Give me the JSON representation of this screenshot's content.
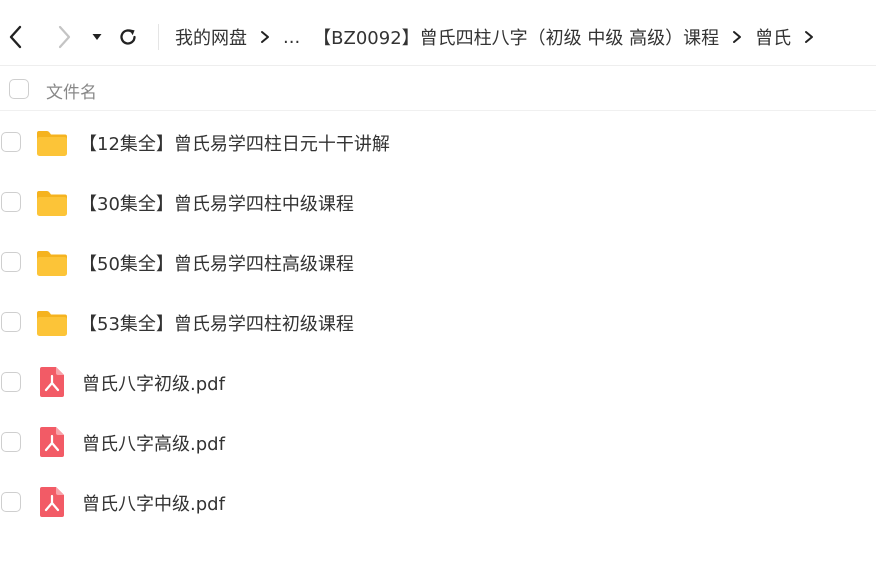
{
  "toolbar": {
    "back_icon": "chevron-left-icon",
    "forward_icon": "chevron-right-icon",
    "history_icon": "caret-down-icon",
    "refresh_icon": "refresh-icon"
  },
  "breadcrumb": [
    {
      "label": "我的网盘"
    },
    {
      "label": "..."
    },
    {
      "label": "【BZ0092】曾氏四柱八字（初级 中级 高级）课程"
    },
    {
      "label": "曾氏"
    }
  ],
  "header": {
    "column_name": "文件名"
  },
  "files": [
    {
      "type": "folder",
      "name": "【12集全】曾氏易学四柱日元十干讲解"
    },
    {
      "type": "folder",
      "name": "【30集全】曾氏易学四柱中级课程"
    },
    {
      "type": "folder",
      "name": "【50集全】曾氏易学四柱高级课程"
    },
    {
      "type": "folder",
      "name": "【53集全】曾氏易学四柱初级课程"
    },
    {
      "type": "pdf",
      "name": "曾氏八字初级.pdf"
    },
    {
      "type": "pdf",
      "name": "曾氏八字高级.pdf"
    },
    {
      "type": "pdf",
      "name": "曾氏八字中级.pdf"
    }
  ],
  "colors": {
    "folder": "#FCC438",
    "folder_back": "#F5B31F",
    "pdf": "#F25B66",
    "text": "#333333",
    "muted": "#888888"
  }
}
